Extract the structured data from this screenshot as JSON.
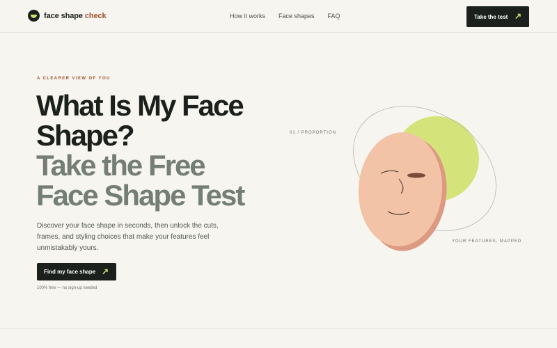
{
  "brand": {
    "name": "face shape",
    "accent_word": "check",
    "logo_icon": "bowl-logo-icon"
  },
  "nav": [
    {
      "label": "How it works"
    },
    {
      "label": "Face shapes"
    },
    {
      "label": "FAQ"
    }
  ],
  "header_cta": {
    "label": "Take the test",
    "icon": "arrow-up-right-icon"
  },
  "hero": {
    "eyebrow": "A CLEARER VIEW OF YOU",
    "title_line1": "What Is My Face Shape?",
    "title_line2": "Take the Free Face Shape Test",
    "description": "Discover your face shape in seconds, then unlock the cuts, frames, and styling choices that make your features feel unmistakably yours.",
    "cta_label": "Find my face shape",
    "note": "100% free — no sign-up needed"
  },
  "illustration": {
    "label_top": "01 / PROPORTION",
    "label_bottom": "YOUR FEATURES, MAPPED"
  },
  "colors": {
    "background": "#f6f5ef",
    "dark": "#1b201c",
    "accent": "#a0502d",
    "lime": "#cfe16e",
    "skin": "#f2c3a6",
    "skin_shadow": "#dd9a82",
    "muted_title": "#747e74"
  }
}
